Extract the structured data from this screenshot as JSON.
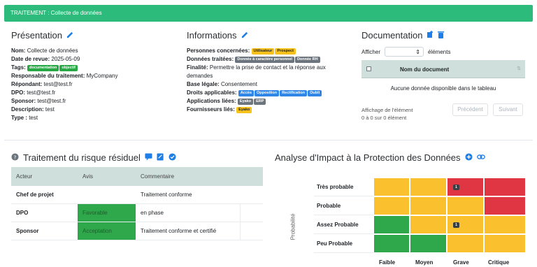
{
  "header": {
    "title": "TRAITEMENT : Collecte de données"
  },
  "presentation": {
    "title": "Présentation",
    "fields": [
      {
        "label": "Nom:",
        "value": "Collecte de données"
      },
      {
        "label": "Date de revue:",
        "value": "2025-05-09"
      },
      {
        "label": "Responsable du traitement:",
        "value": "MyCompany"
      },
      {
        "label": "Répondant:",
        "value": "test@test.fr"
      },
      {
        "label": "DPO:",
        "value": "test@test.fr"
      },
      {
        "label": "Sponsor:",
        "value": "test@test.fr"
      },
      {
        "label": "Description:",
        "value": "test"
      },
      {
        "label": "Type :",
        "value": "test"
      }
    ],
    "tags_label": "Tags:",
    "tags": [
      "documentation",
      "objectif"
    ]
  },
  "informations": {
    "title": "Informations",
    "personnes_label": "Personnes concernées:",
    "personnes": [
      "Utilisateur",
      "Prospect"
    ],
    "donnees_label": "Données traitées:",
    "donnees": [
      "Donnée à caractère personnel",
      "Donnée RH"
    ],
    "finalite_label": "Finalité:",
    "finalite": "Permettre la prise de contact et la réponse aux demandes",
    "base_label": "Base légale:",
    "base": "Consentement",
    "droits_label": "Droits applicables:",
    "droits": [
      "Accès",
      "Opposition",
      "Rectification",
      "Oubli"
    ],
    "applications_label": "Applications liées:",
    "applications": [
      "Eyako",
      "ERP"
    ],
    "fournisseurs_label": "Fournisseurs liés:",
    "fournisseurs": [
      "Eyako"
    ]
  },
  "documentation": {
    "title": "Documentation",
    "show_label": "Afficher",
    "elements_label": "éléments",
    "column": "Nom du document",
    "empty": "Aucune donnée disponible dans le tableau",
    "info_line1": "Affichage de l'élément",
    "info_line2": "0 à 0 sur 0 élément",
    "prev": "Précédent",
    "next": "Suivant"
  },
  "risk": {
    "title": "Traitement du risque résiduel",
    "headers": [
      "Acteur",
      "Avis",
      "Commentaire"
    ],
    "rows": [
      {
        "acteur": "Chef de projet",
        "avis": "",
        "commentaire": "Traitement conforme"
      },
      {
        "acteur": "DPO",
        "avis": "Favorable",
        "commentaire": "en phase"
      },
      {
        "acteur": "Sponsor",
        "avis": "Acceptation",
        "commentaire": "Traitement conforme et certifié"
      }
    ]
  },
  "aipd": {
    "title": "Analyse d'Impact à la Protection des Données",
    "y_axis": "Probabilité",
    "rows": [
      "Très probable",
      "Probable",
      "Assez Probable",
      "Peu Probable"
    ],
    "cols": [
      "Faible",
      "Moyen",
      "Grave",
      "Critique"
    ],
    "colors": {
      "yellow": "#fbc02d",
      "red": "#e03643",
      "green": "#2ea84a"
    },
    "marker": "1"
  }
}
